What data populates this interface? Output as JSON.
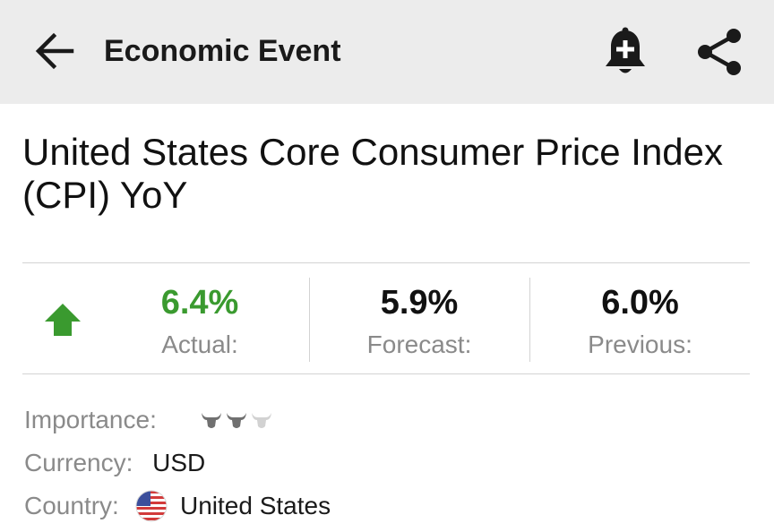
{
  "app_bar": {
    "title": "Economic Event",
    "back_icon": "arrow-left-icon",
    "alert_icon": "bell-plus-icon",
    "share_icon": "share-icon"
  },
  "event": {
    "title": "United States Core Consumer Price Index (CPI) YoY",
    "trend": "up",
    "trend_color": "#3a9a2f"
  },
  "stats": {
    "actual": {
      "value": "6.4%",
      "label": "Actual:",
      "color": "#3a9a2f"
    },
    "forecast": {
      "value": "5.9%",
      "label": "Forecast:"
    },
    "previous": {
      "value": "6.0%",
      "label": "Previous:"
    }
  },
  "details": {
    "importance_label": "Importance:",
    "importance_level": 2,
    "importance_max": 3,
    "currency_label": "Currency:",
    "currency_value": "USD",
    "country_label": "Country:",
    "country_value": "United States",
    "country_flag_icon": "us-flag-icon"
  }
}
